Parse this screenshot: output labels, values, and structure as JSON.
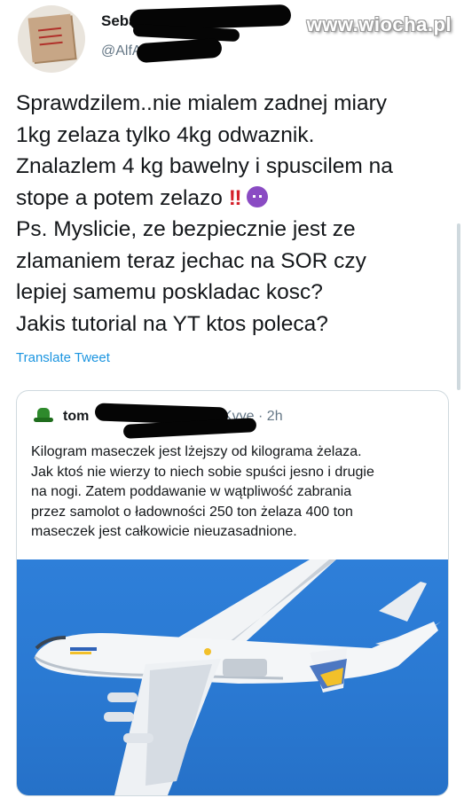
{
  "watermark": "www.wiocha.pl",
  "author": {
    "name_visible": "Seba",
    "handle_visible": "@AlfA"
  },
  "tweet": {
    "text": "Sprawdzilem..nie mialem zadnej miary\n1kg zelaza tylko 4kg odwaznik.\nZnalazlem 4 kg bawelny i spuscilem na\nstope a potem zelazo",
    "emoji": [
      "double-exclamation-emoji",
      "smiling-devil-emoji"
    ],
    "text_after_emoji": "Ps. Myslicie, ze bezpiecznie jest ze\nzlamaniem teraz jechac na SOR czy\nlepiej samemu poskladac kosc?\nJakis tutorial na YT ktos poleca?",
    "double_exclamation": "‼",
    "translate_label": "Translate Tweet"
  },
  "quoted_tweet": {
    "name_visible": "tom",
    "time_visible": "Kvye · 2h",
    "text": "Kilogram maseczek jest lżejszy od kilograma żelaza.\nJak ktoś nie wierzy to niech sobie spuści jesno i drugie\nna nogi. Zatem poddawanie w wątpliwość zabrania\nprzez samolot o ładowności 250 ton żelaza 400 ton\nmaseczek jest całkowicie nieuzasadnione.",
    "image": "cargo-airplane-in-blue-sky"
  },
  "colors": {
    "link": "#1b95e0",
    "sky": "#2e7fd9",
    "secondary_text": "#657786"
  }
}
